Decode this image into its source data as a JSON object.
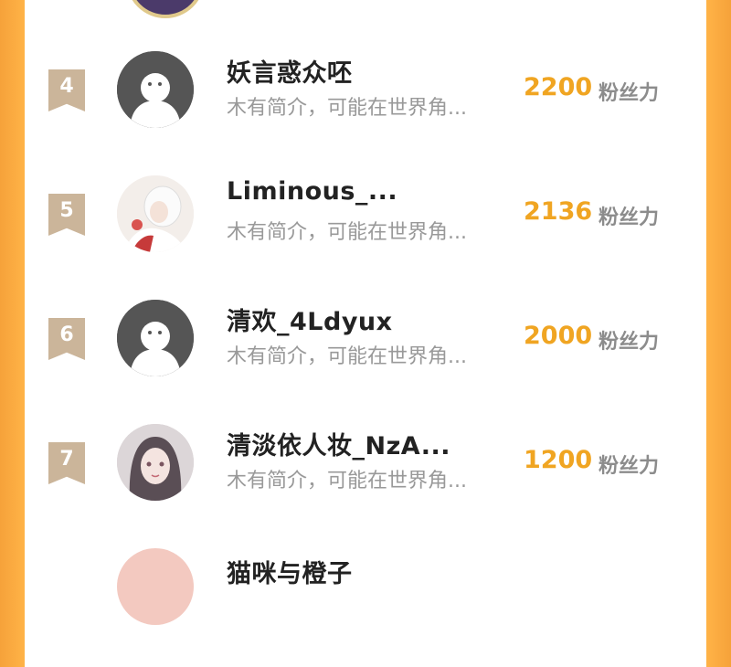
{
  "rows": [
    {
      "rank": "4",
      "name": "妖言惑众呸",
      "bio": "木有简介，可能在世界角...",
      "score": "2200",
      "unit": "粉丝力",
      "avatar": "default-avatar-icon"
    },
    {
      "rank": "5",
      "name": "Liminous_...",
      "bio": "木有简介，可能在世界角...",
      "score": "2136",
      "unit": "粉丝力",
      "avatar": "anime-girl-white-hair-photo"
    },
    {
      "rank": "6",
      "name": "清欢_4Ldyux",
      "bio": "木有简介，可能在世界角...",
      "score": "2000",
      "unit": "粉丝力",
      "avatar": "default-avatar-icon"
    },
    {
      "rank": "7",
      "name": "清淡依人妆_NzA...",
      "bio": "木有简介，可能在世界角...",
      "score": "1200",
      "unit": "粉丝力",
      "avatar": "anime-girl-dark-hair-photo"
    }
  ],
  "next_row": {
    "name": "猫咪与橙子"
  },
  "colors": {
    "accent": "#f0a522",
    "rank_badge": "#cbb59a",
    "frame": "#ffb347"
  }
}
